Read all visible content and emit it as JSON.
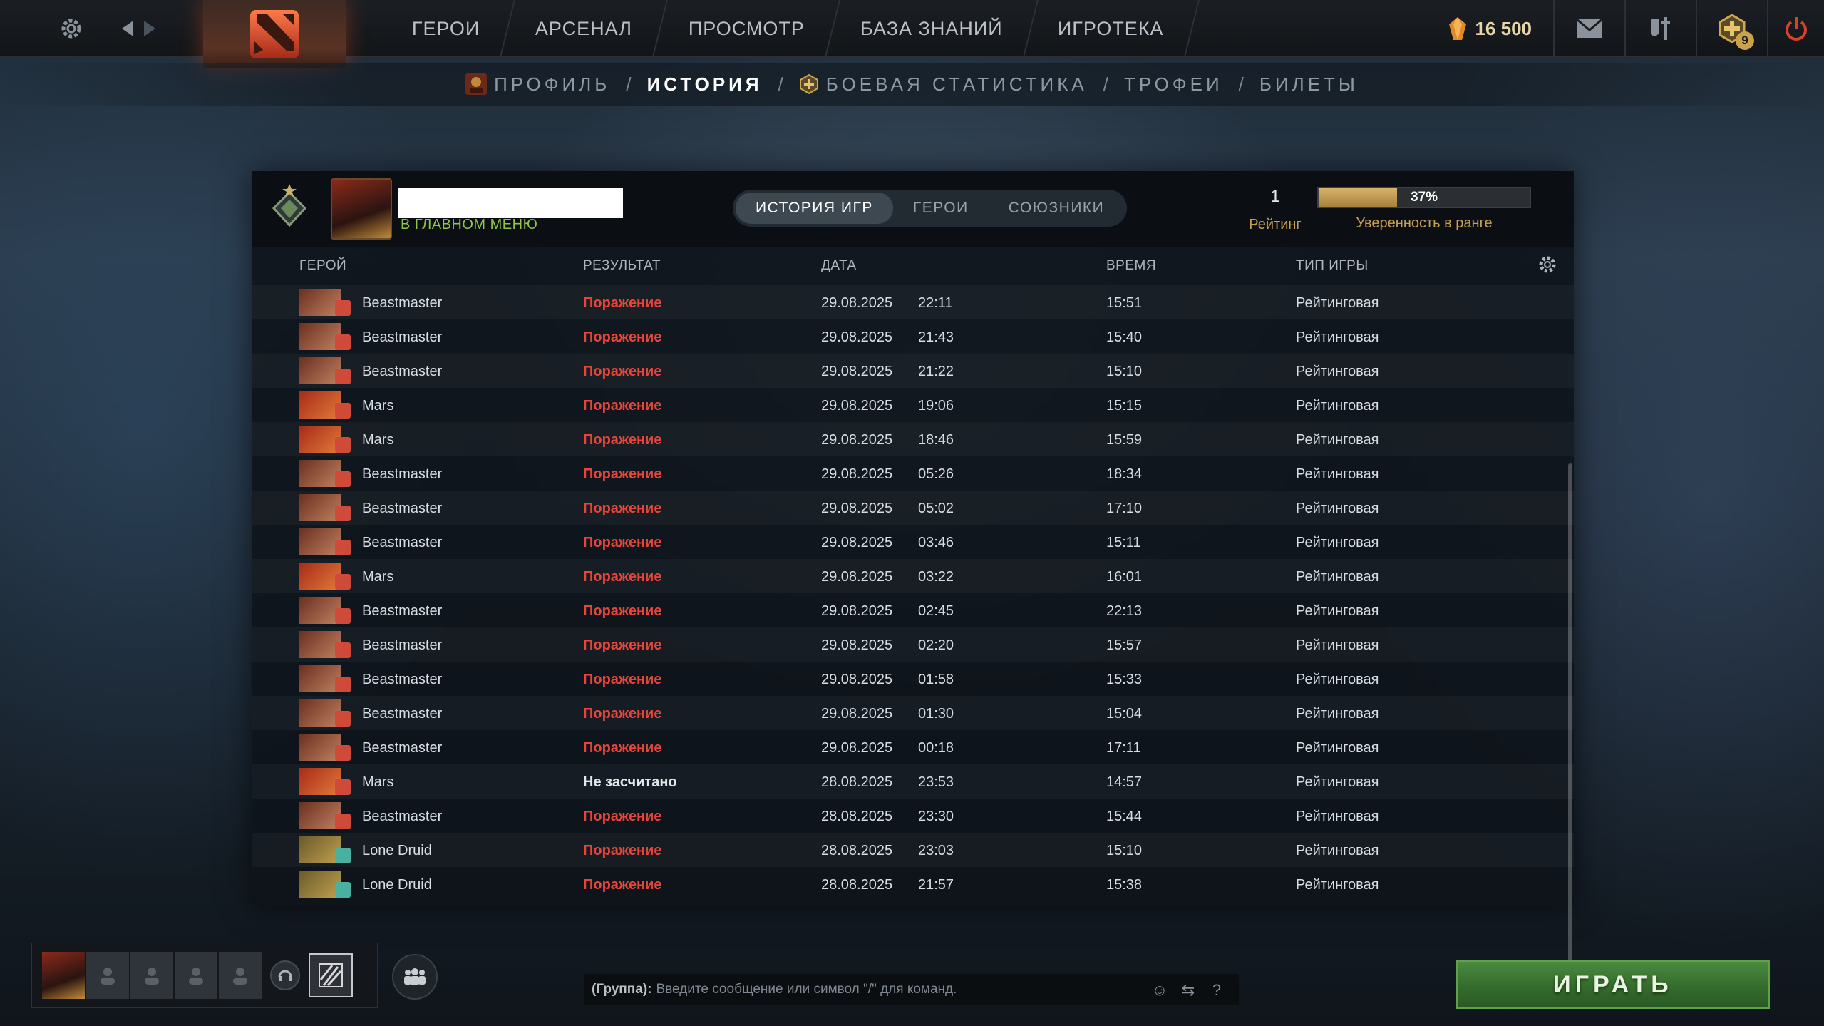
{
  "topbar": {
    "nav": [
      "ГЕРОИ",
      "АРСЕНАЛ",
      "ПРОСМОТР",
      "БАЗА ЗНАНИЙ",
      "ИГРОТЕКА"
    ],
    "currency": "16 500",
    "notification_count": "9"
  },
  "subnav": {
    "profile": "ПРОФИЛЬ",
    "history": "ИСТОРИЯ",
    "battle_stats": "БОЕВАЯ СТАТИСТИКА",
    "trophies": "ТРОФЕИ",
    "tickets": "БИЛЕТЫ",
    "sep": "/"
  },
  "profile": {
    "status": "В ГЛАВНОМ МЕНЮ",
    "tabs": [
      "ИСТОРИЯ ИГР",
      "ГЕРОИ",
      "СОЮЗНИКИ"
    ],
    "rating_value": "1",
    "rating_label": "Рейтинг",
    "confidence_pct": "37%",
    "confidence_value": 37,
    "confidence_label": "Уверенность в ранге"
  },
  "columns": {
    "hero": "ГЕРОЙ",
    "result": "РЕЗУЛЬТАТ",
    "date": "ДАТА",
    "time": "ВРЕМЯ",
    "game_type": "ТИП ИГРЫ"
  },
  "matches": [
    {
      "hero": "Beastmaster",
      "result": "Поражение",
      "date": "29.08.2025",
      "clock": "22:11",
      "duration": "15:51",
      "type": "Рейтинговая"
    },
    {
      "hero": "Beastmaster",
      "result": "Поражение",
      "date": "29.08.2025",
      "clock": "21:43",
      "duration": "15:40",
      "type": "Рейтинговая"
    },
    {
      "hero": "Beastmaster",
      "result": "Поражение",
      "date": "29.08.2025",
      "clock": "21:22",
      "duration": "15:10",
      "type": "Рейтинговая"
    },
    {
      "hero": "Mars",
      "result": "Поражение",
      "date": "29.08.2025",
      "clock": "19:06",
      "duration": "15:15",
      "type": "Рейтинговая"
    },
    {
      "hero": "Mars",
      "result": "Поражение",
      "date": "29.08.2025",
      "clock": "18:46",
      "duration": "15:59",
      "type": "Рейтинговая"
    },
    {
      "hero": "Beastmaster",
      "result": "Поражение",
      "date": "29.08.2025",
      "clock": "05:26",
      "duration": "18:34",
      "type": "Рейтинговая"
    },
    {
      "hero": "Beastmaster",
      "result": "Поражение",
      "date": "29.08.2025",
      "clock": "05:02",
      "duration": "17:10",
      "type": "Рейтинговая"
    },
    {
      "hero": "Beastmaster",
      "result": "Поражение",
      "date": "29.08.2025",
      "clock": "03:46",
      "duration": "15:11",
      "type": "Рейтинговая"
    },
    {
      "hero": "Mars",
      "result": "Поражение",
      "date": "29.08.2025",
      "clock": "03:22",
      "duration": "16:01",
      "type": "Рейтинговая"
    },
    {
      "hero": "Beastmaster",
      "result": "Поражение",
      "date": "29.08.2025",
      "clock": "02:45",
      "duration": "22:13",
      "type": "Рейтинговая"
    },
    {
      "hero": "Beastmaster",
      "result": "Поражение",
      "date": "29.08.2025",
      "clock": "02:20",
      "duration": "15:57",
      "type": "Рейтинговая"
    },
    {
      "hero": "Beastmaster",
      "result": "Поражение",
      "date": "29.08.2025",
      "clock": "01:58",
      "duration": "15:33",
      "type": "Рейтинговая"
    },
    {
      "hero": "Beastmaster",
      "result": "Поражение",
      "date": "29.08.2025",
      "clock": "01:30",
      "duration": "15:04",
      "type": "Рейтинговая"
    },
    {
      "hero": "Beastmaster",
      "result": "Поражение",
      "date": "29.08.2025",
      "clock": "00:18",
      "duration": "17:11",
      "type": "Рейтинговая"
    },
    {
      "hero": "Mars",
      "result": "Не засчитано",
      "date": "28.08.2025",
      "clock": "23:53",
      "duration": "14:57",
      "type": "Рейтинговая"
    },
    {
      "hero": "Beastmaster",
      "result": "Поражение",
      "date": "28.08.2025",
      "clock": "23:30",
      "duration": "15:44",
      "type": "Рейтинговая"
    },
    {
      "hero": "Lone Druid",
      "result": "Поражение",
      "date": "28.08.2025",
      "clock": "23:03",
      "duration": "15:10",
      "type": "Рейтинговая"
    },
    {
      "hero": "Lone Druid",
      "result": "Поражение",
      "date": "28.08.2025",
      "clock": "21:57",
      "duration": "15:38",
      "type": "Рейтинговая"
    }
  ],
  "chat": {
    "channel": "(Группа):",
    "placeholder": "Введите сообщение или символ \"/\" для команд.",
    "help": "?"
  },
  "play_label": "ИГРАТЬ",
  "colors": {
    "loss": "#e8443a",
    "accent_gold": "#c8a050",
    "online_green": "#8ec44a",
    "play_green": "#3f7a34"
  }
}
